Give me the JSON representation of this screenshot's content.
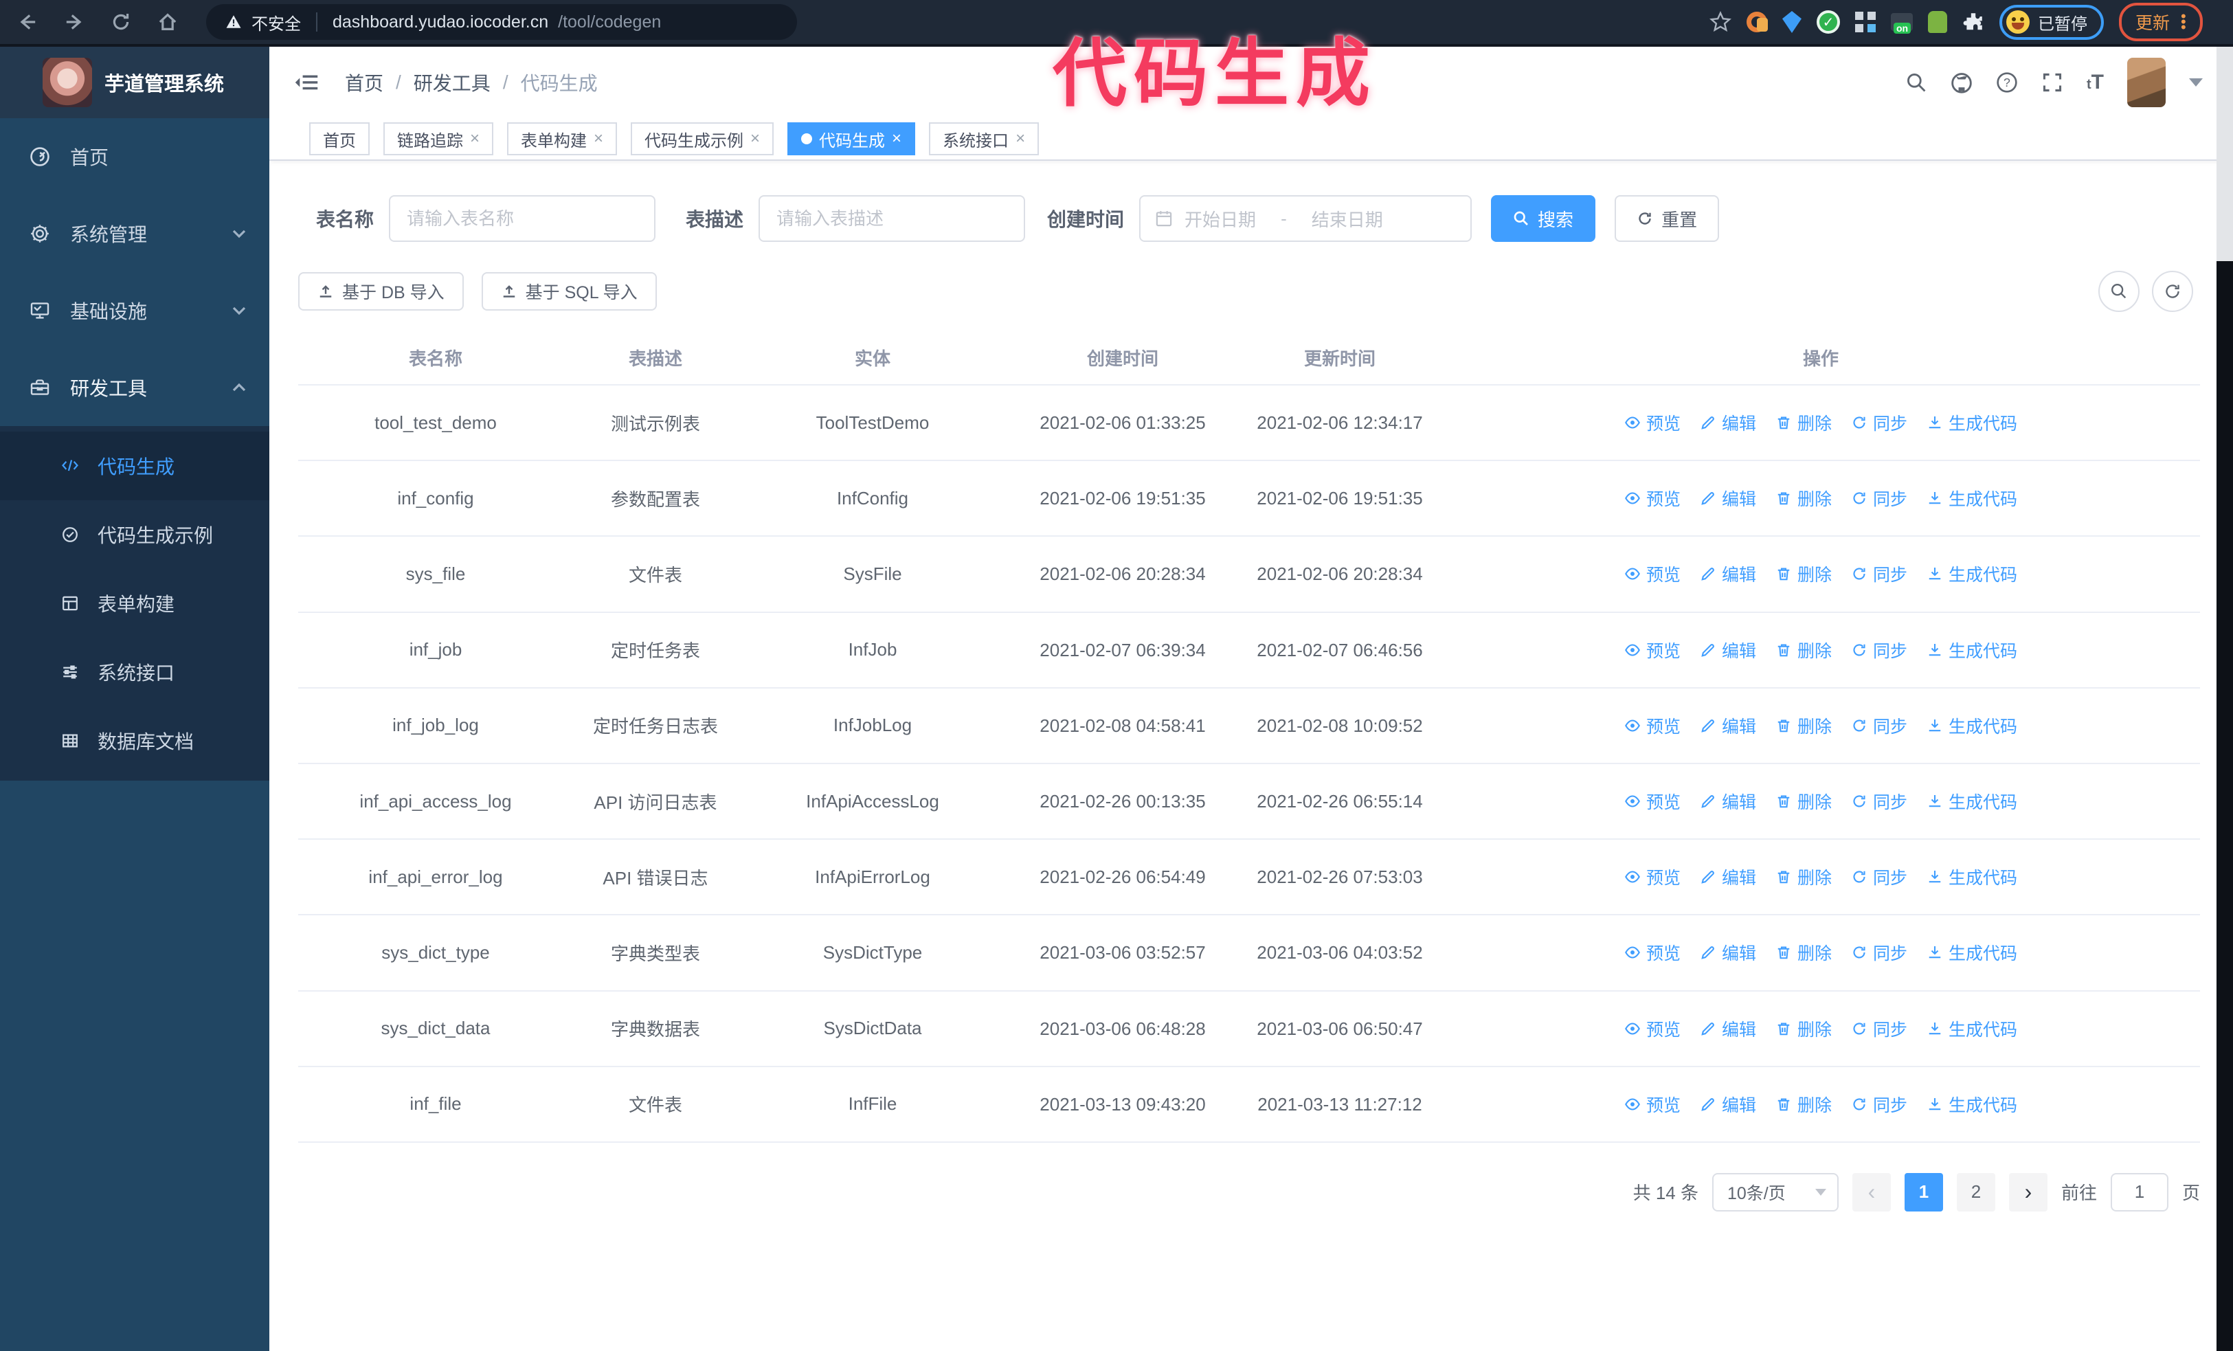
{
  "browser": {
    "security_label": "不安全",
    "url_host": "dashboard.yudao.iocoder.cn",
    "url_path": "/tool/codegen",
    "profile_badge": "已暂停",
    "update_label": "更新",
    "extension_badge": "on"
  },
  "annotation": {
    "text": "代码生成",
    "color": "#f43b5f"
  },
  "header": {
    "logo_title": "芋道管理系统",
    "breadcrumb": [
      "首页",
      "研发工具",
      "代码生成"
    ],
    "font_size_icon_label": "tT"
  },
  "sidebar": {
    "items": [
      {
        "label": "首页"
      },
      {
        "label": "系统管理"
      },
      {
        "label": "基础设施"
      },
      {
        "label": "研发工具"
      }
    ],
    "subitems": [
      {
        "label": "代码生成"
      },
      {
        "label": "代码生成示例"
      },
      {
        "label": "表单构建"
      },
      {
        "label": "系统接口"
      },
      {
        "label": "数据库文档"
      }
    ]
  },
  "tabs": [
    {
      "label": "首页"
    },
    {
      "label": "链路追踪"
    },
    {
      "label": "表单构建"
    },
    {
      "label": "代码生成示例"
    },
    {
      "label": "代码生成"
    },
    {
      "label": "系统接口"
    }
  ],
  "filters": {
    "name_label": "表名称",
    "name_placeholder": "请输入表名称",
    "desc_label": "表描述",
    "desc_placeholder": "请输入表描述",
    "time_label": "创建时间",
    "start_placeholder": "开始日期",
    "range_separator": "-",
    "end_placeholder": "结束日期",
    "search_label": "搜索",
    "reset_label": "重置"
  },
  "toolbar": {
    "import_db_label": "基于 DB 导入",
    "import_sql_label": "基于 SQL 导入"
  },
  "table": {
    "columns": [
      "表名称",
      "表描述",
      "实体",
      "创建时间",
      "更新时间",
      "操作"
    ],
    "action_labels": [
      "预览",
      "编辑",
      "删除",
      "同步",
      "生成代码"
    ],
    "rows": [
      {
        "name": "tool_test_demo",
        "desc": "测试示例表",
        "entity": "ToolTestDemo",
        "created": "2021-02-06 01:33:25",
        "updated": "2021-02-06 12:34:17"
      },
      {
        "name": "inf_config",
        "desc": "参数配置表",
        "entity": "InfConfig",
        "created": "2021-02-06 19:51:35",
        "updated": "2021-02-06 19:51:35"
      },
      {
        "name": "sys_file",
        "desc": "文件表",
        "entity": "SysFile",
        "created": "2021-02-06 20:28:34",
        "updated": "2021-02-06 20:28:34"
      },
      {
        "name": "inf_job",
        "desc": "定时任务表",
        "entity": "InfJob",
        "created": "2021-02-07 06:39:34",
        "updated": "2021-02-07 06:46:56"
      },
      {
        "name": "inf_job_log",
        "desc": "定时任务日志表",
        "entity": "InfJobLog",
        "created": "2021-02-08 04:58:41",
        "updated": "2021-02-08 10:09:52"
      },
      {
        "name": "inf_api_access_log",
        "desc": "API 访问日志表",
        "entity": "InfApiAccessLog",
        "created": "2021-02-26 00:13:35",
        "updated": "2021-02-26 06:55:14"
      },
      {
        "name": "inf_api_error_log",
        "desc": "API 错误日志",
        "entity": "InfApiErrorLog",
        "created": "2021-02-26 06:54:49",
        "updated": "2021-02-26 07:53:03"
      },
      {
        "name": "sys_dict_type",
        "desc": "字典类型表",
        "entity": "SysDictType",
        "created": "2021-03-06 03:52:57",
        "updated": "2021-03-06 04:03:52"
      },
      {
        "name": "sys_dict_data",
        "desc": "字典数据表",
        "entity": "SysDictData",
        "created": "2021-03-06 06:48:28",
        "updated": "2021-03-06 06:50:47"
      },
      {
        "name": "inf_file",
        "desc": "文件表",
        "entity": "InfFile",
        "created": "2021-03-13 09:43:20",
        "updated": "2021-03-13 11:27:12"
      }
    ]
  },
  "pagination": {
    "total_text": "共 14 条",
    "page_size_label": "10条/页",
    "pages": [
      "1",
      "2"
    ],
    "active_page": "1",
    "goto_label": "前往",
    "goto_value": "1",
    "goto_unit": "页"
  },
  "colors": {
    "primary": "#409eff",
    "annotation_pink": "#f43b5f",
    "topbar_bg": "#1f2937",
    "sidebar_bg": "#214663",
    "submenu_bg": "#1b3048"
  }
}
